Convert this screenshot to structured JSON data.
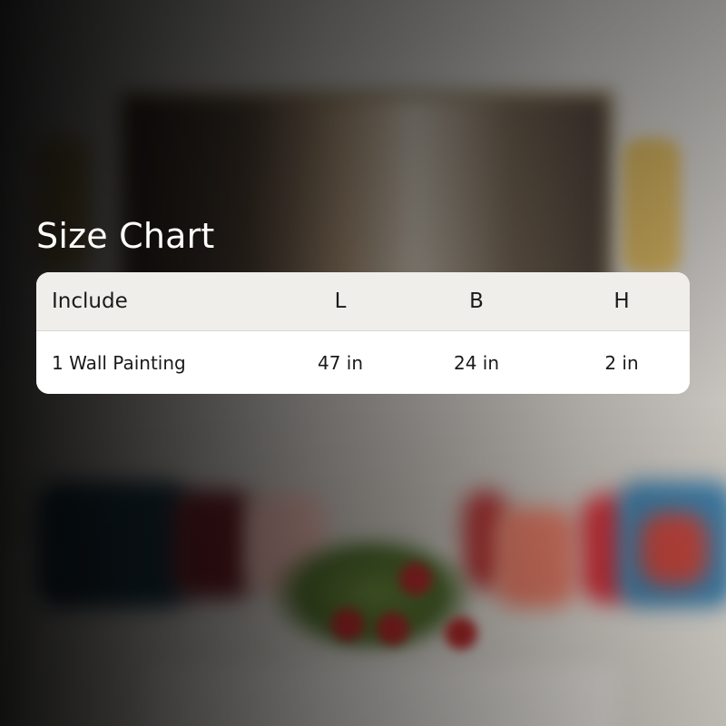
{
  "title": "Size Chart",
  "table": {
    "headers": [
      "Include",
      "L",
      "B",
      "H"
    ],
    "rows": [
      [
        "1 Wall Painting",
        "47 in",
        "24 in",
        "2 in"
      ]
    ]
  },
  "colors": {
    "title_text": "#ffffff",
    "header_bg": "#efeeeb",
    "row_bg": "#ffffff",
    "text": "#1a1a1a"
  }
}
